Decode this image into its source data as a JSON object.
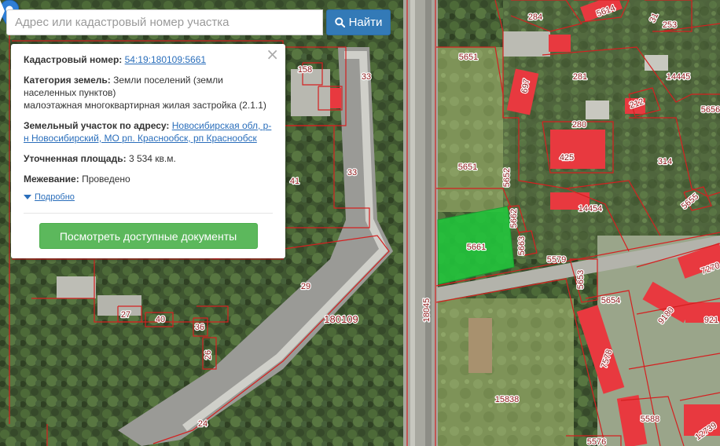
{
  "search": {
    "placeholder": "Адрес или кадастровый номер участка",
    "button_label": "Найти",
    "button_icon": "search-icon"
  },
  "info": {
    "cadastral_label": "Кадастровый номер:",
    "cadastral_value": "54:19:180109:5661",
    "category_label": "Категория земель:",
    "category_value": "Земли поселений (земли населенных пунктов)",
    "category_use": "малоэтажная многоквартирная жилая застройка (2.1.1)",
    "address_label": "Земельный участок по адресу:",
    "address_value": "Новосибирская обл, р-н Новосибирский, МО рп. Краснообск, рп Краснообск",
    "area_label": "Уточненная площадь:",
    "area_value": "3 534 кв.м.",
    "survey_label": "Межевание:",
    "survey_value": "Проведено",
    "more_label": "Подробно",
    "docs_button": "Посмотреть доступные документы",
    "close_icon": "close-icon"
  },
  "map": {
    "selected_plot": "5661",
    "quarter_label": "180109",
    "road_label": "18045",
    "plot_labels": [
      "158",
      "33",
      "33",
      "41",
      "29",
      "27",
      "40",
      "36",
      "26",
      "24",
      "5651",
      "5651",
      "5652",
      "5662",
      "5663",
      "5579",
      "5653",
      "5654",
      "7578",
      "5588",
      "5576",
      "15838",
      "284",
      "5614",
      "253",
      "281",
      "14445",
      "697",
      "212",
      "5656",
      "280",
      "425",
      "314",
      "14454",
      "5655",
      "7270",
      "9180",
      "921",
      "12739",
      "31"
    ],
    "colors": {
      "boundary": "#d42020",
      "selected_fill": "#22c43c",
      "building": "#e8393f",
      "pin": "#2f7fd6"
    }
  }
}
